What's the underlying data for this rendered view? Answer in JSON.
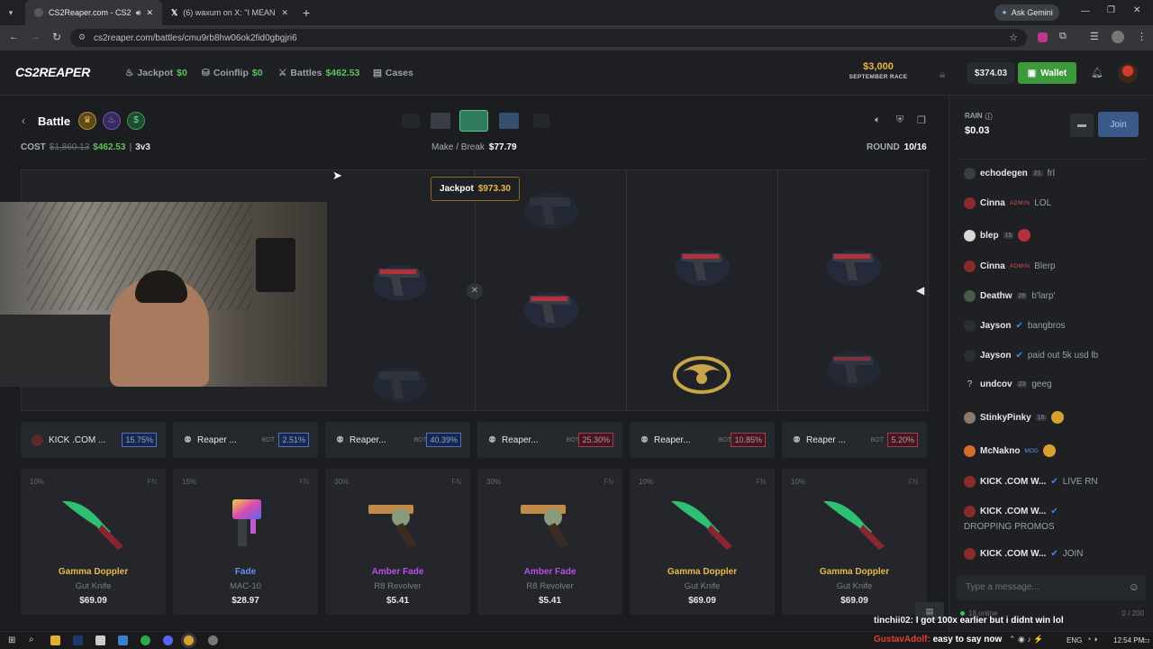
{
  "browser": {
    "tabs": [
      {
        "title": "CS2Reaper.com - CS2 Jackp",
        "active": true
      },
      {
        "title": "(6) waxum on X: \"I MEAN IT DO",
        "active": false
      }
    ],
    "ask_gemini": "Ask Gemini",
    "url": "cs2reaper.com/battles/cmu9rb8hw06ok2fid0gbgjri6"
  },
  "header": {
    "logo": "CS2REAPER",
    "nav": [
      {
        "label": "Jackpot",
        "value": "$0",
        "icon": "jackpot-icon"
      },
      {
        "label": "Coinflip",
        "value": "$0",
        "icon": "coin-icon"
      },
      {
        "label": "Battles",
        "value": "$462.53",
        "icon": "swords-icon"
      },
      {
        "label": "Cases",
        "value": "",
        "icon": "case-icon"
      }
    ],
    "race_amount": "$3,000",
    "race_label": "SEPTEMBER RACE",
    "balance": "$374.03",
    "wallet_label": "Wallet"
  },
  "battle": {
    "title": "Battle",
    "cost_label": "COST",
    "cost_old": "$1,860.13",
    "cost_new": "$462.53",
    "mode": "3v3",
    "make_break_label": "Make / Break",
    "make_break_value": "$77.79",
    "round_label": "ROUND",
    "round_value": "10/16",
    "jackpot_label": "Jackpot",
    "jackpot_value": "$973.30"
  },
  "players": [
    {
      "name": "KICK .COM ...",
      "bot": "",
      "pct": "15.75%",
      "color": "blue"
    },
    {
      "name": "Reaper ...",
      "bot": "BOT",
      "pct": "2.51%",
      "color": "blue"
    },
    {
      "name": "Reaper...",
      "bot": "BOT",
      "pct": "40.39%",
      "color": "blue"
    },
    {
      "name": "Reaper...",
      "bot": "BOT",
      "pct": "25.30%",
      "color": "red"
    },
    {
      "name": "Reaper...",
      "bot": "BOT",
      "pct": "10.85%",
      "color": "red"
    },
    {
      "name": "Reaper ...",
      "bot": "BOT",
      "pct": "5.20%",
      "color": "red"
    }
  ],
  "items": [
    {
      "chance": "10%",
      "cond": "FN",
      "name": "Gamma Doppler",
      "weapon": "Gut Knife",
      "price": "$69.09",
      "color": "#e9b949"
    },
    {
      "chance": "15%",
      "cond": "FN",
      "name": "Fade",
      "weapon": "MAC-10",
      "price": "$28.97",
      "color": "#6b8ef0"
    },
    {
      "chance": "30%",
      "cond": "FN",
      "name": "Amber Fade",
      "weapon": "R8 Revolver",
      "price": "$5.41",
      "color": "#b552e6"
    },
    {
      "chance": "30%",
      "cond": "FN",
      "name": "Amber Fade",
      "weapon": "R8 Revolver",
      "price": "$5.41",
      "color": "#b552e6"
    },
    {
      "chance": "10%",
      "cond": "FN",
      "name": "Gamma Doppler",
      "weapon": "Gut Knife",
      "price": "$69.09",
      "color": "#e9b949"
    },
    {
      "chance": "10%",
      "cond": "FN",
      "name": "Gamma Doppler",
      "weapon": "Gut Knife",
      "price": "$69.09",
      "color": "#e9b949"
    }
  ],
  "chat": {
    "rain_label": "RAIN",
    "rain_value": "$0.03",
    "join_label": "Join",
    "messages": [
      {
        "user": "echodegen",
        "badge": "21",
        "badge_type": "lvl",
        "text": "frl"
      },
      {
        "user": "Cinna",
        "badge": "ADMIN",
        "badge_type": "admin",
        "text": "LOL"
      },
      {
        "user": "blep",
        "badge": "15",
        "badge_type": "lvl",
        "text": ""
      },
      {
        "user": "Cinna",
        "badge": "ADMIN",
        "badge_type": "admin",
        "text": "Blerp"
      },
      {
        "user": "Deathw",
        "badge": "28",
        "badge_type": "lvl",
        "text": "b'larp'"
      },
      {
        "user": "Jayson",
        "badge": "",
        "badge_type": "verified",
        "text": "bangbros"
      },
      {
        "user": "Jayson",
        "badge": "",
        "badge_type": "verified",
        "text": "paid out 5k usd lb"
      },
      {
        "user": "undcov",
        "badge": "23",
        "badge_type": "lvl",
        "text": "geeg"
      },
      {
        "user": "StinkyPinky",
        "badge": "16",
        "badge_type": "lvl",
        "text": ""
      },
      {
        "user": "McNakno",
        "badge": "MOD",
        "badge_type": "mod",
        "text": ""
      },
      {
        "user": "KICK .COM W...",
        "badge": "",
        "badge_type": "verified",
        "text": "LIVE RN"
      },
      {
        "user": "KICK .COM W...",
        "badge": "",
        "badge_type": "verified",
        "text": "DROPPING PROMOS"
      },
      {
        "user": "KICK .COM W...",
        "badge": "",
        "badge_type": "verified",
        "text": "JOIN"
      }
    ],
    "input_placeholder": "Type a message...",
    "online": "18 online",
    "char_count": "0 / 200"
  },
  "overlay_chat": [
    {
      "user": "tinchii02:",
      "text": "I got 100x earlier but i didnt win lol",
      "user_color": "#f0f0f0"
    },
    {
      "user": "GustavAdolf:",
      "text": "easy to say now",
      "user_color": "#e0403a"
    }
  ],
  "taskbar": {
    "lang": "ENG",
    "time": "12:54 PM"
  }
}
